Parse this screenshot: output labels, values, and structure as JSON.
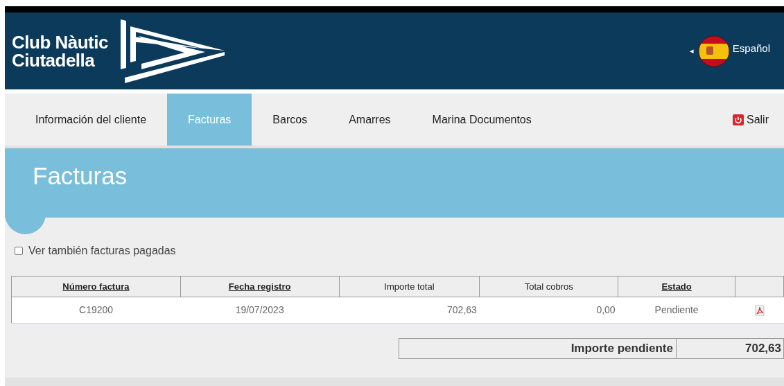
{
  "header": {
    "logo_text": [
      "Club Nàutic",
      "Ciutadella"
    ],
    "language": {
      "arrow": "◂",
      "label": "Español"
    }
  },
  "nav": {
    "tabs": [
      {
        "label": "Información del cliente",
        "selected": false
      },
      {
        "label": "Facturas",
        "selected": true
      },
      {
        "label": "Barcos",
        "selected": false
      },
      {
        "label": "Amarres",
        "selected": false
      },
      {
        "label": "Marina Documentos",
        "selected": false
      }
    ],
    "logout": "Salir"
  },
  "page_title": "Facturas",
  "filter": {
    "label": "Ver también facturas pagadas",
    "checked": false
  },
  "table": {
    "columns": [
      {
        "label": "Número factura",
        "sortable": true,
        "kind": "text"
      },
      {
        "label": "Fecha registro",
        "sortable": true,
        "kind": "text"
      },
      {
        "label": "Importe total",
        "sortable": false,
        "kind": "amount"
      },
      {
        "label": "Total cobros",
        "sortable": false,
        "kind": "amount"
      },
      {
        "label": "Estado",
        "sortable": true,
        "kind": "text"
      },
      {
        "kind": "pdf"
      }
    ],
    "rows": [
      [
        "C19200",
        "19/07/2023",
        "702,63",
        "0,00",
        "Pendiente"
      ]
    ]
  },
  "summary": {
    "label": "Importe pendiente",
    "value": "702,63"
  }
}
